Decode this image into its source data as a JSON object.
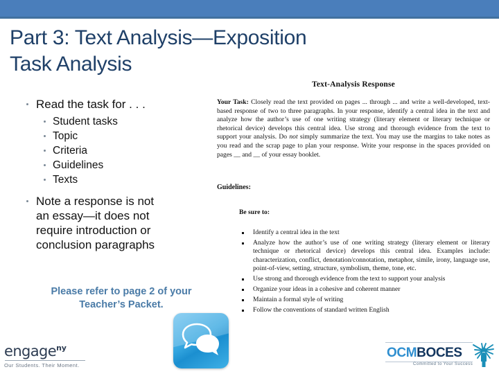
{
  "slide": {
    "title_line1": "Part 3: Text Analysis—Exposition",
    "title_line2": "Task Analysis",
    "accent_bar_color": "#4a7ebb",
    "title_color": "#1f4068"
  },
  "outline": {
    "bullet1": "Read the task for . . .",
    "sub_bullets": [
      "Student tasks",
      "Topic",
      "Criteria",
      "Guidelines",
      "Texts"
    ],
    "bullet2_lines": [
      "Note a response is not",
      "an essay—it does not",
      "require introduction or",
      "conclusion paragraphs"
    ],
    "packet_note_line1": "Please refer to page 2 of your",
    "packet_note_line2": "Teacher’s Packet.",
    "packet_note_color": "#4a7ba7"
  },
  "document": {
    "heading": "Text-Analysis Response",
    "task_label": "Your Task:",
    "task_body_part1": " Closely read the text provided on pages ... through ... and write a well-developed, text-based response of two to three paragraphs.  In your response, identify a central idea in the text and analyze how the author’s use of one writing strategy (literary element or literary technique or rhetorical device) develops this central idea.  Use strong and thorough evidence from the text to support your analysis.  Do ",
    "task_emphasis": "not",
    "task_body_part2": " simply summarize the text.  You may use the margins to take notes as you read and the scrap page to plan your response.  Write your response in the spaces provided on pages __ and __ of your essay booklet.",
    "guidelines_label": "Guidelines:",
    "be_sure_to_label": "Be sure to:",
    "guidelines": [
      "Identify a central idea in the text",
      "Analyze how the author’s use of one writing strategy (literary element or literary technique or rhetorical device) develops this central idea.  Examples include: characterization, conflict, denotation/connotation, metaphor, simile, irony, language use, point-of-view, setting, structure, symbolism, theme, tone, etc.",
      "Use strong and thorough evidence from the text to support your analysis",
      "Organize your ideas in a cohesive and coherent manner",
      "Maintain a formal style of writing",
      "Follow the conventions of standard written English"
    ]
  },
  "icons": {
    "speech_bubble": "speech-bubble-icon"
  },
  "logos": {
    "engageny_word": "engage",
    "engageny_sup": "ny",
    "engageny_tagline": "Our Students. Their Moment.",
    "ocm": "OCM",
    "boces": "BOCES",
    "ocm_tagline": "Committed to Your Success"
  }
}
